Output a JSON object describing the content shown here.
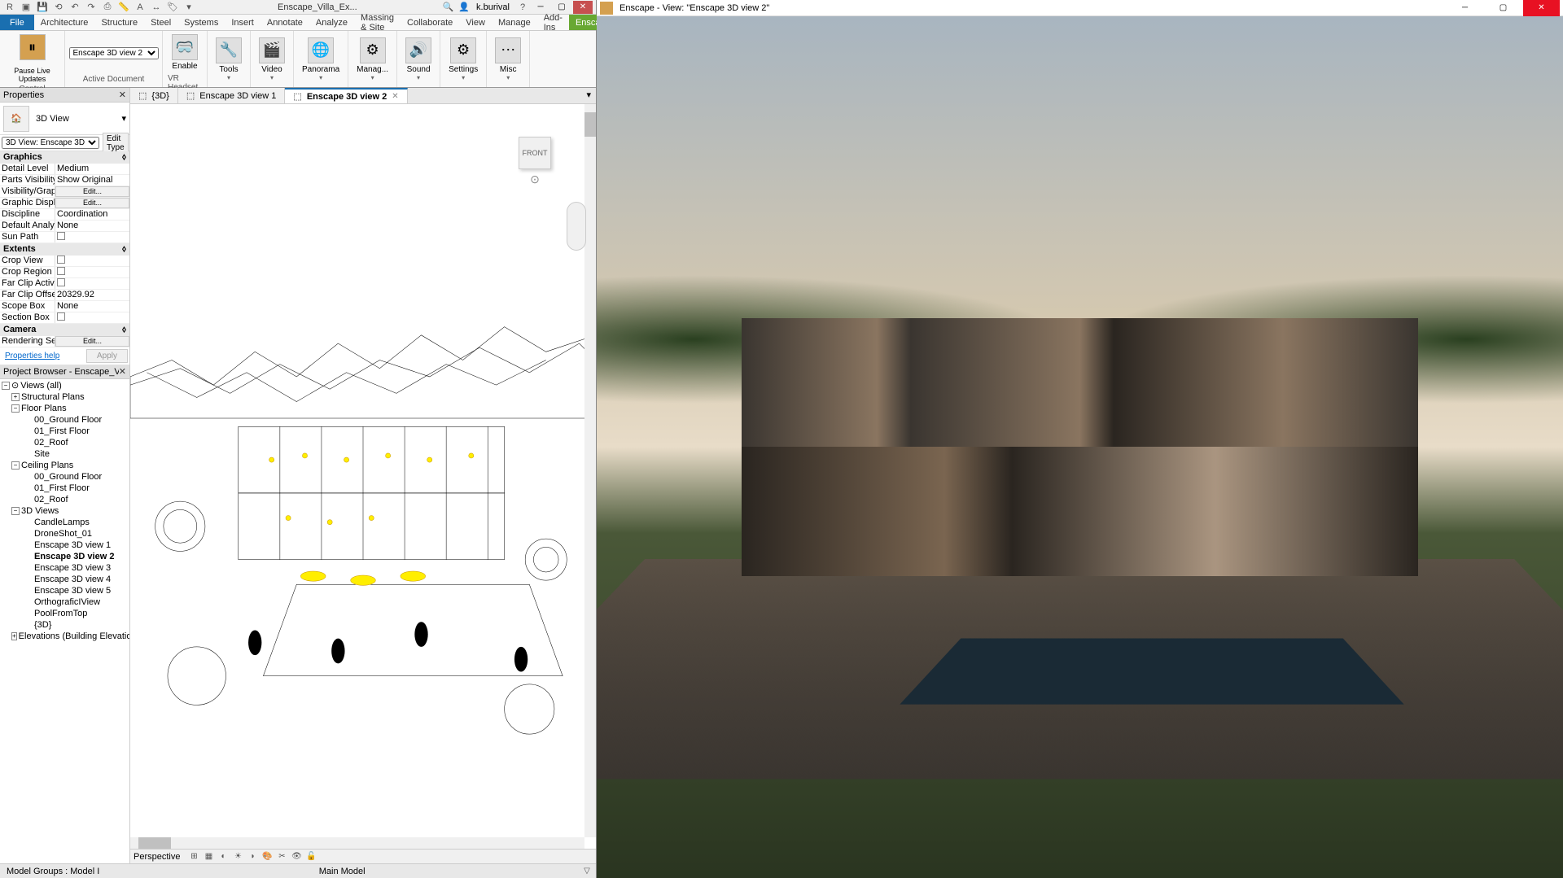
{
  "revit": {
    "titlebar": {
      "project": "Enscape_Villa_Ex...",
      "user": "k.burival"
    },
    "ribbon_tabs": [
      "Architecture",
      "Structure",
      "Steel",
      "Systems",
      "Insert",
      "Annotate",
      "Analyze",
      "Massing & Site",
      "Collaborate",
      "View",
      "Manage",
      "Add-Ins",
      "Enscape™"
    ],
    "file_tab": "File",
    "ribbon": {
      "control_group": "Control",
      "pause_label": "Pause Live Updates",
      "active_doc": "Active Document",
      "active_doc_value": "Enscape 3D view 2",
      "vr_group": "VR Headset",
      "enable_label": "Enable",
      "buttons": [
        {
          "label": "Tools"
        },
        {
          "label": "Video"
        },
        {
          "label": "Panorama"
        },
        {
          "label": "Manag..."
        },
        {
          "label": "Sound"
        },
        {
          "label": "Settings"
        },
        {
          "label": "Misc"
        }
      ]
    },
    "view_tabs": [
      {
        "label": "{3D}",
        "icon": "cube"
      },
      {
        "label": "Enscape 3D view 1",
        "icon": "cube"
      },
      {
        "label": "Enscape 3D view 2",
        "icon": "cube",
        "active": true
      }
    ],
    "properties": {
      "title": "Properties",
      "type": "3D View",
      "instance": "3D View: Enscape 3D",
      "edit_type": "Edit Type",
      "sections": {
        "graphics": {
          "label": "Graphics",
          "rows": [
            {
              "label": "Detail Level",
              "value": "Medium"
            },
            {
              "label": "Parts Visibility",
              "value": "Show Original"
            },
            {
              "label": "Visibility/Grap...",
              "value": "Edit...",
              "btn": true
            },
            {
              "label": "Graphic Displ...",
              "value": "Edit...",
              "btn": true
            },
            {
              "label": "Discipline",
              "value": "Coordination"
            },
            {
              "label": "Default Analy...",
              "value": "None"
            },
            {
              "label": "Sun Path",
              "value": "",
              "check": true
            }
          ]
        },
        "extents": {
          "label": "Extents",
          "rows": [
            {
              "label": "Crop View",
              "value": "",
              "check": true
            },
            {
              "label": "Crop Region ...",
              "value": "",
              "check": true
            },
            {
              "label": "Far Clip Active",
              "value": "",
              "check": true
            },
            {
              "label": "Far Clip Offset",
              "value": "20329.92"
            },
            {
              "label": "Scope Box",
              "value": "None"
            },
            {
              "label": "Section Box",
              "value": "",
              "check": true
            }
          ]
        },
        "camera": {
          "label": "Camera",
          "rows": [
            {
              "label": "Rendering Set...",
              "value": "Edit...",
              "btn": true
            }
          ]
        }
      },
      "help": "Properties help",
      "apply": "Apply"
    },
    "browser": {
      "title": "Project Browser - Enscape_Villa_Ext...",
      "views_root": "Views (all)",
      "groups": [
        {
          "label": "Structural Plans",
          "items": []
        },
        {
          "label": "Floor Plans",
          "items": [
            "00_Ground Floor",
            "01_First Floor",
            "02_Roof",
            "Site"
          ]
        },
        {
          "label": "Ceiling Plans",
          "items": [
            "00_Ground Floor",
            "01_First Floor",
            "02_Roof"
          ]
        },
        {
          "label": "3D Views",
          "items": [
            "CandleLamps",
            "DroneShot_01",
            "Enscape 3D view 1",
            "Enscape 3D view 2",
            "Enscape 3D view 3",
            "Enscape 3D view 4",
            "Enscape 3D view 5",
            "OrthograficIView",
            "PoolFromTop",
            "{3D}"
          ],
          "bold_item": "Enscape 3D view 2"
        },
        {
          "label": "Elevations (Building Elevation"
        }
      ]
    },
    "viewcube": "FRONT",
    "view_toolbar": {
      "mode": "Perspective"
    },
    "status": {
      "left": "Model Groups : Model I",
      "center": "Main Model"
    }
  },
  "enscape": {
    "title": "Enscape - View: \"Enscape 3D view 2\""
  }
}
